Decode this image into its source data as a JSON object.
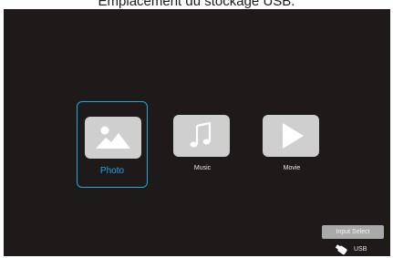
{
  "caption": "Emplacement du stockage USB.",
  "tiles": [
    {
      "label": "Photo",
      "icon": "photo-icon",
      "selected": true
    },
    {
      "label": "Music",
      "icon": "music-note-icon",
      "selected": false
    },
    {
      "label": "Movie",
      "icon": "play-icon",
      "selected": false
    }
  ],
  "footer": {
    "input_select_label": "Input Select",
    "source_label": "USB",
    "source_icon": "usb-stick-icon"
  },
  "colors": {
    "background": "#1f1a1a",
    "accent": "#1aa9df",
    "tile": "#cfcfcf"
  }
}
